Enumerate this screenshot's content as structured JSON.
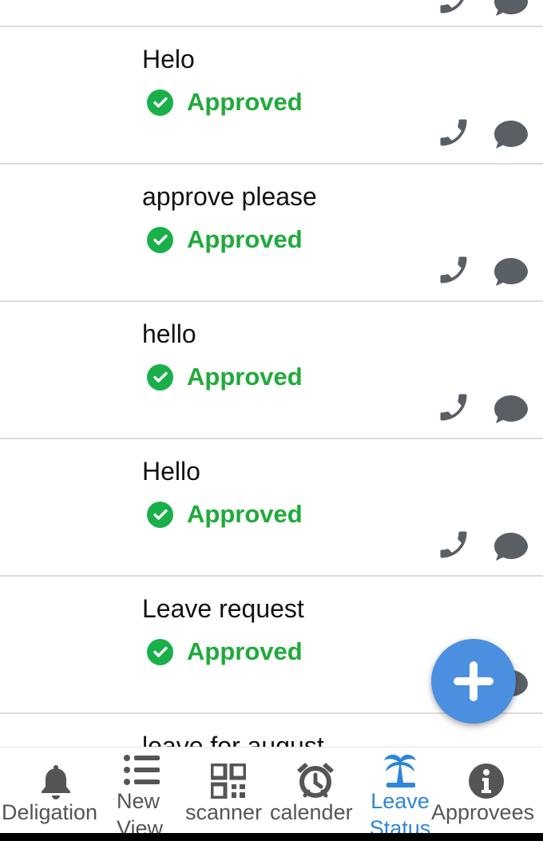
{
  "leave_items": [
    {
      "title": "Helo",
      "status": "Approved"
    },
    {
      "title": "approve please",
      "status": "Approved"
    },
    {
      "title": "hello",
      "status": "Approved"
    },
    {
      "title": "Hello",
      "status": "Approved"
    },
    {
      "title": "Leave request",
      "status": "Approved"
    },
    {
      "title": "leave for august",
      "status": ""
    }
  ],
  "nav": {
    "items": [
      {
        "label": "Deligation",
        "icon": "bell-icon"
      },
      {
        "label": "New View",
        "icon": "list-icon"
      },
      {
        "label": "scanner",
        "icon": "qr-code-icon"
      },
      {
        "label": "calender",
        "icon": "alarm-clock-icon"
      },
      {
        "label": "Leave Status",
        "icon": "palm-tree-icon",
        "active": true
      },
      {
        "label": "Approvees",
        "icon": "info-icon"
      }
    ]
  },
  "colors": {
    "approved": "#1faa3a",
    "accent": "#2e86d8",
    "fab": "#4a8fe0",
    "icon_gray": "#555555"
  }
}
